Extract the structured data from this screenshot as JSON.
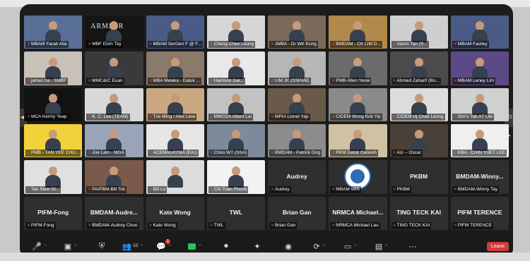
{
  "participants": [
    {
      "label": "MBAM Farah Alia",
      "active": true,
      "bg": "#5a6f96",
      "type": "video"
    },
    {
      "label": "MBF Elvin Tay",
      "bg": "#151515",
      "type": "armstrong",
      "overlay": "ARMSTR"
    },
    {
      "label": "MBAM SerGen F @ F...",
      "bg": "#4a5c86",
      "type": "video"
    },
    {
      "label": "Cheng Chee Leong",
      "bg": "#d6d6d6",
      "type": "video"
    },
    {
      "label": "JMBA - Dr WK Kong",
      "bg": "#7a6a5a",
      "type": "video"
    },
    {
      "label": "BMDAM - CK LIM D...",
      "bg": "#b08a4a",
      "type": "video"
    },
    {
      "label": "Aaron Tan (S...",
      "bg": "#cfcfcf",
      "type": "video"
    },
    {
      "label": "MBAM Faizley",
      "bg": "#4a5c86",
      "type": "video"
    },
    {
      "label": "james ha - SMBF",
      "bg": "#c8c2b8",
      "type": "video"
    },
    {
      "label": "MMC&IC Euan",
      "bg": "#3a3a3a",
      "type": "video"
    },
    {
      "label": "MBA Melaka - Datuk ...",
      "bg": "#8a7a6a",
      "type": "video"
    },
    {
      "label": "Harrison Jue...",
      "bg": "#e8e8e8",
      "type": "video"
    },
    {
      "label": "LIM JK (SSPAM)",
      "bg": "#b6b6b6",
      "type": "video"
    },
    {
      "label": "PMB-Allen Yeow",
      "bg": "#6b6b6b",
      "type": "video"
    },
    {
      "label": "Ahmed Zaharif (Bo...",
      "bg": "#4b4b4b",
      "type": "video"
    },
    {
      "label": "MBAM Leney Lim",
      "bg": "#5c4a86",
      "type": "video"
    },
    {
      "label": "MCA Kenny Yeap",
      "bg": "#121212",
      "type": "video"
    },
    {
      "label": "K. C. Lee (TEAM)",
      "bg": "#d8d8d8",
      "type": "video"
    },
    {
      "label": "Tze Ming / Alex Liew",
      "bg": "#caa882",
      "type": "video"
    },
    {
      "label": "MMCDA Albert Lai",
      "bg": "#c2c2c2",
      "type": "video"
    },
    {
      "label": "MPIA Lionel Yap",
      "bg": "#6a5a4a",
      "type": "video"
    },
    {
      "label": "CIDEM Wong Kok Yip",
      "bg": "#8a8a8a",
      "type": "video"
    },
    {
      "label": "CIDEM Hj Chee Leong",
      "bg": "#dcdcdc",
      "type": "video"
    },
    {
      "label": "Sim's Tab A7 Lite",
      "bg": "#d0d0d0",
      "type": "video"
    },
    {
      "label": "PMB - TAN YEE CHU...",
      "bg": "#f2d23a",
      "type": "video"
    },
    {
      "label": "Joe Lam - MGA",
      "bg": "#9aa4b8",
      "type": "video"
    },
    {
      "label": "ACEMALAYSIA (Eric)",
      "bg": "#e6e6e6",
      "type": "video"
    },
    {
      "label": "Choo WT (SSA)",
      "bg": "#7d8a9c",
      "type": "video"
    },
    {
      "label": "BMDAM - Patrick Ong",
      "bg": "#8c8c8c",
      "type": "video"
    },
    {
      "label": "PKM Datuk Ganesh",
      "bg": "#cfc2a4",
      "type": "video"
    },
    {
      "label": "Aci -- Oscar",
      "bg": "#4a4038",
      "type": "video"
    },
    {
      "label": "KBA - CHIN YUET LEE",
      "bg": "#efefef",
      "type": "video"
    },
    {
      "label": "Tan Siew Gi...",
      "bg": "#e0e0e0",
      "type": "video"
    },
    {
      "label": "PA/PBM-Bill Tok",
      "bg": "#7a5a4a",
      "type": "video"
    },
    {
      "label": "Bill Lo",
      "bg": "#dcdcdc",
      "type": "video"
    },
    {
      "label": "Chi Tuan Phone",
      "bg": "#f2f2f2",
      "type": "video"
    },
    {
      "label": "Audrey",
      "bg": "#2f2f2f",
      "type": "name",
      "bigname": "Audrey"
    },
    {
      "label": "MBAM WIS",
      "bg": "#2f2f2f",
      "type": "logo"
    },
    {
      "label": "PKBM",
      "bg": "#2f2f2f",
      "type": "name",
      "bigname": "PKBM"
    },
    {
      "label": "BMDAM-Winny Tay",
      "bg": "#2f2f2f",
      "type": "name",
      "bigname": "BMDAM-Winny..."
    },
    {
      "label": "PIFM-Fong",
      "bg": "#2f2f2f",
      "type": "name",
      "bigname": "PIFM-Fong"
    },
    {
      "label": "BMDAM-Audrey Choo",
      "bg": "#2f2f2f",
      "type": "name",
      "bigname": "BMDAM-Audre..."
    },
    {
      "label": "Kate Wong",
      "bg": "#2f2f2f",
      "type": "name",
      "bigname": "Kate Wong"
    },
    {
      "label": "TWL",
      "bg": "#2f2f2f",
      "type": "name",
      "bigname": "TWL"
    },
    {
      "label": "Brian Gan",
      "bg": "#2f2f2f",
      "type": "name",
      "bigname": "Brian Gan"
    },
    {
      "label": "NRMCA Michael Lau",
      "bg": "#2f2f2f",
      "type": "name",
      "bigname": "NRMCA Michael..."
    },
    {
      "label": "TING TECK KAI",
      "bg": "#2f2f2f",
      "type": "name",
      "bigname": "TING TECK KAI"
    },
    {
      "label": "PIFM TERENCE",
      "bg": "#2f2f2f",
      "type": "name",
      "bigname": "PIFM TERENCE"
    }
  ],
  "toolbar": {
    "participants_count": "53",
    "chat_badge": "1",
    "leave_label": "Leave"
  },
  "nav": {
    "prev_symbol": "◀",
    "next_symbol": "1/2 ▶"
  },
  "colors": {
    "active_outline": "#e6d23a",
    "mute_icon": "#e84b4b",
    "leave_button": "#d23b3b"
  }
}
